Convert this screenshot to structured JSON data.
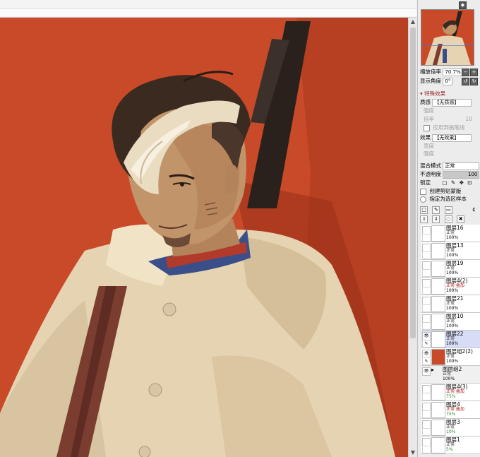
{
  "navigator": {
    "zoom_label": "缩放倍率",
    "zoom_value": "70.7%",
    "angle_label": "显示角度",
    "angle_value": "0°"
  },
  "effects": {
    "header": "特殊效果",
    "texture_label": "质感",
    "texture_value": "【无质感】",
    "texture_sub1": "强度",
    "texture_sub2": "倍率",
    "texture_sub2_value": "10",
    "texture_check": "应用到画笔线",
    "effect_label": "效果",
    "effect_value": "【无效果】",
    "effect_sub1": "宽度",
    "effect_sub2": "强度"
  },
  "blend": {
    "mode_label": "混合模式",
    "mode_value": "正常",
    "opacity_label": "不透明度",
    "opacity_value": "100",
    "lock_label": "锁定",
    "clip_label": "创建剪贴蒙版",
    "sample_label": "指定为选区样本"
  },
  "layers": [
    {
      "name": "图层16",
      "mode": "正常",
      "opacity": "100%",
      "mode_color": "normal"
    },
    {
      "name": "图层13",
      "mode": "正常",
      "opacity": "100%",
      "mode_color": "normal"
    },
    {
      "name": "图层19",
      "mode": "正常",
      "opacity": "100%",
      "mode_color": "normal"
    },
    {
      "name": "图层4(2)",
      "mode": "正常  叠加",
      "opacity": "100%",
      "mode_color": "mixed"
    },
    {
      "name": "图层21",
      "mode": "正常",
      "opacity": "100%",
      "mode_color": "normal"
    },
    {
      "name": "图层10",
      "mode": "正常",
      "opacity": "100%",
      "mode_color": "normal"
    },
    {
      "name": "图层22",
      "mode": "正常",
      "opacity": "100%",
      "mode_color": "normal",
      "selected": true
    },
    {
      "name": "图层组2(2)",
      "mode": "正常",
      "opacity": "100%",
      "mode_color": "normal"
    },
    {
      "name": "图层组2",
      "mode": "正常",
      "opacity": "100%",
      "mode_color": "normal",
      "folder": true
    },
    {
      "name": "图层4(3)",
      "mode": "正常  叠加",
      "opacity": "75%",
      "mode_color": "mixed"
    },
    {
      "name": "图层4",
      "mode": "正常  叠加",
      "opacity": "75%",
      "mode_color": "mixed"
    },
    {
      "name": "图层3",
      "mode": "正常",
      "opacity": "10%",
      "mode_color": "normal"
    },
    {
      "name": "图层1",
      "mode": "正常",
      "opacity": "5%",
      "mode_color": "normal"
    }
  ],
  "colors": {
    "background_red": "#c84a28",
    "cloak": "#e6d3b2",
    "uniform_blue": "#3a4f8a",
    "collar_red": "#b23a2a",
    "hair": "#3b2a20",
    "skin": "#c29469",
    "rifle": "#2a211d",
    "strap": "#7a3d2f",
    "selected_layer": "#d7dcf7"
  }
}
